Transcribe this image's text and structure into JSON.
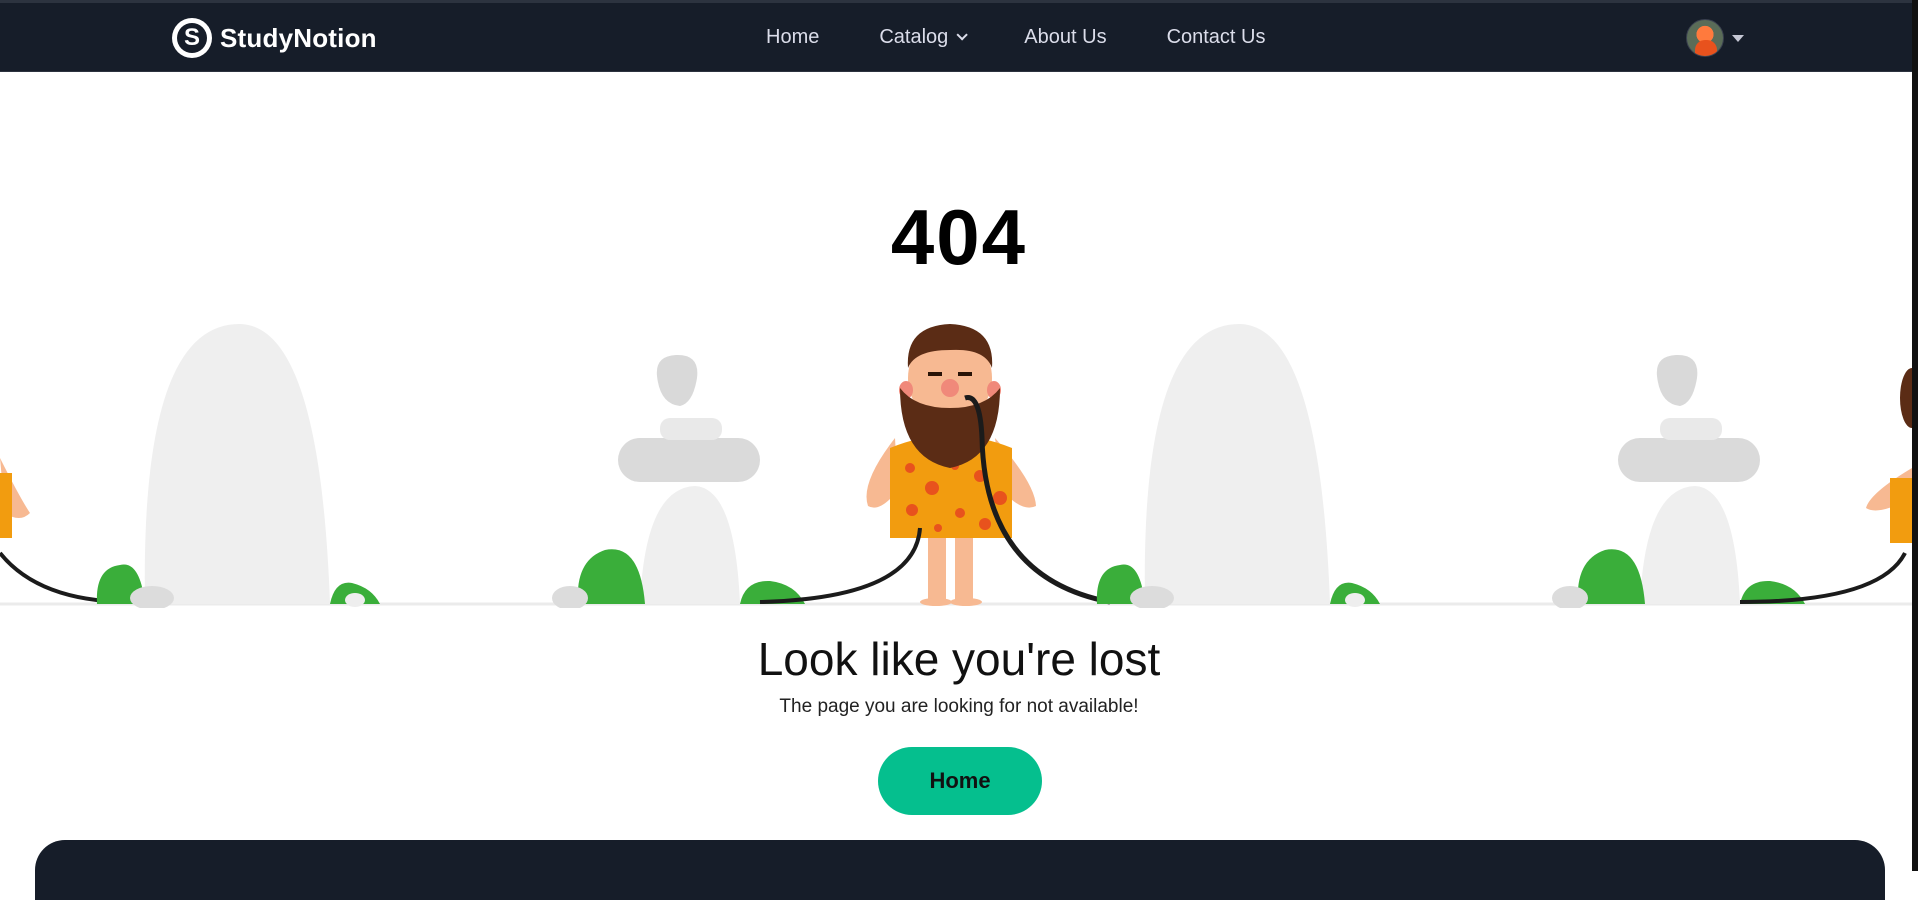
{
  "navbar": {
    "logo_text": "StudyNotion",
    "links": {
      "home": "Home",
      "catalog": "Catalog",
      "about": "About Us",
      "contact": "Contact Us"
    }
  },
  "error": {
    "code": "404",
    "title": "Look like you're lost",
    "subtitle": "The page you are looking for not available!",
    "button_label": "Home"
  },
  "colors": {
    "navbar_bg": "#161d29",
    "accent_button": "#05bf8e",
    "text_dark": "#000000"
  },
  "icons": {
    "logo": "study-notion-logo-icon",
    "catalog_chevron": "chevron-down-icon",
    "profile_caret": "caret-down-icon"
  }
}
